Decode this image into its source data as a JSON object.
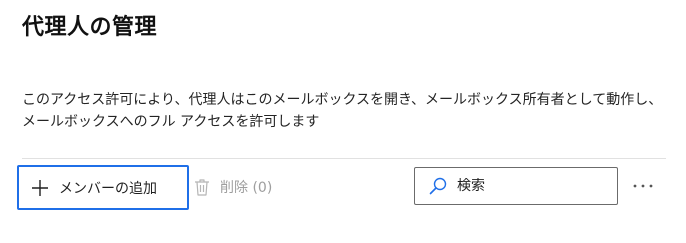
{
  "page": {
    "title": "代理人の管理",
    "description": "このアクセス許可により、代理人はこのメールボックスを開き、メールボックス所有者として動作し、メールボックスへのフル アクセスを許可します"
  },
  "toolbar": {
    "add": {
      "label": "メンバーの追加",
      "icon": "plus-icon"
    },
    "delete": {
      "label": "削除 (0)",
      "icon": "trash-icon",
      "enabled": false
    },
    "search": {
      "placeholder": "検索",
      "value": "",
      "icon": "search-icon"
    },
    "more": {
      "icon": "more-horizontal-icon",
      "glyph": "···"
    }
  },
  "colors": {
    "focus_border": "#1f6fe8",
    "disabled_text": "#9e9e9e",
    "text": "#1f1f1f"
  }
}
